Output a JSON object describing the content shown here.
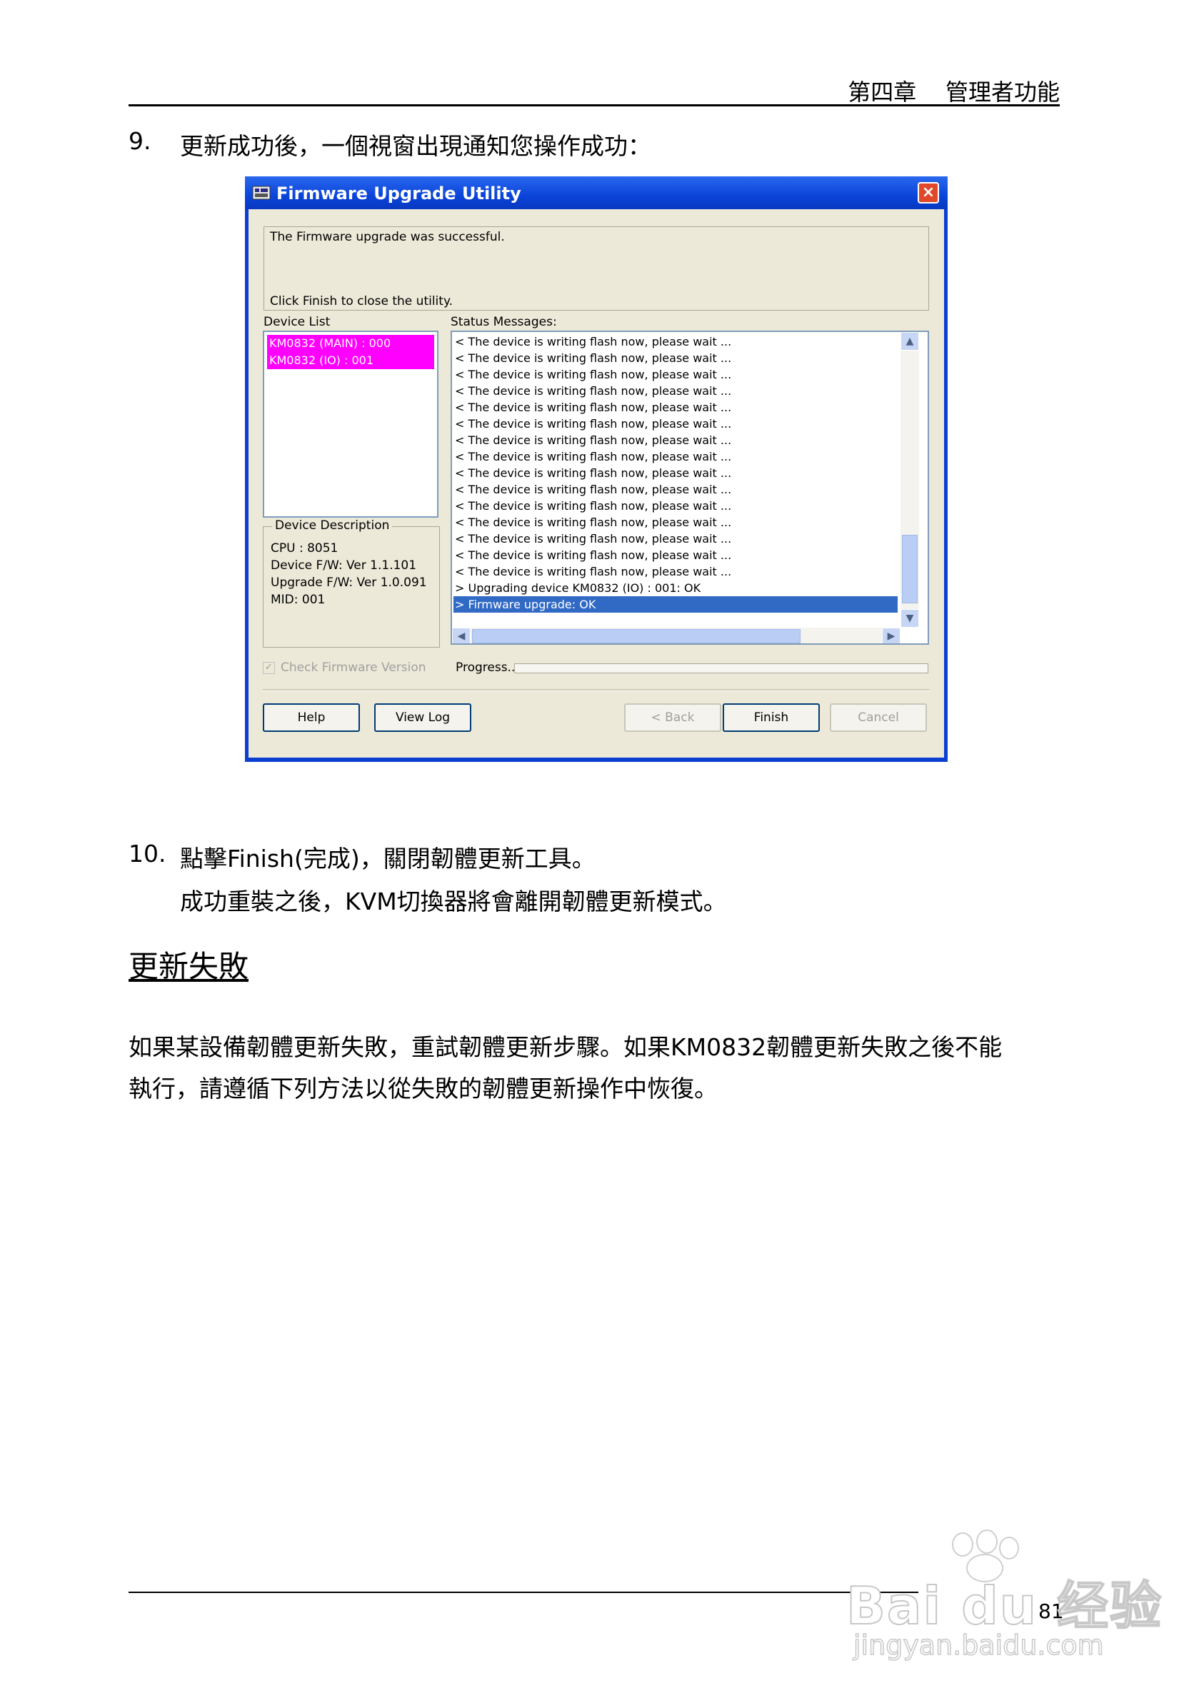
{
  "header": {
    "chapter": "第四章    管理者功能"
  },
  "step9": {
    "number": "9.",
    "text": "更新成功後，一個視窗出現通知您操作成功："
  },
  "dialog": {
    "title": "Firmware Upgrade Utility",
    "close_glyph": "×",
    "message_line1": "The Firmware upgrade was successful.",
    "message_line2": "Click Finish to close the utility.",
    "device_list_label": "Device List",
    "devices": [
      "KM0832 (MAIN) : 000",
      "KM0832 (IO) : 001"
    ],
    "status_label": "Status Messages:",
    "status_messages": [
      "< The device is writing flash now, please wait ...",
      "< The device is writing flash now, please wait ...",
      "< The device is writing flash now, please wait ...",
      "< The device is writing flash now, please wait ...",
      "< The device is writing flash now, please wait ...",
      "< The device is writing flash now, please wait ...",
      "< The device is writing flash now, please wait ...",
      "< The device is writing flash now, please wait ...",
      "< The device is writing flash now, please wait ...",
      "< The device is writing flash now, please wait ...",
      "< The device is writing flash now, please wait ...",
      "< The device is writing flash now, please wait ...",
      "< The device is writing flash now, please wait ...",
      "< The device is writing flash now, please wait ...",
      "< The device is writing flash now, please wait ...",
      "> Upgrading device KM0832 (IO) : 001: OK",
      "> Firmware upgrade: OK"
    ],
    "device_description": {
      "title": "Device Description",
      "lines": [
        "CPU : 8051",
        "Device F/W: Ver 1.1.101",
        "Upgrade F/W: Ver 1.0.091",
        "MID: 001"
      ]
    },
    "check_label": "Check Firmware Version",
    "progress_label": "Progress...",
    "buttons": {
      "help": "Help",
      "view_log": "View Log",
      "back": "< Back",
      "finish": "Finish",
      "cancel": "Cancel"
    }
  },
  "step10": {
    "number": "10.",
    "line1": "點擊Finish(完成)，關閉韌體更新工具。",
    "line2": "成功重裝之後，KVM切換器將會離開韌體更新模式。"
  },
  "section": {
    "title": "更新失敗",
    "para_line1": "如果某設備韌體更新失敗，重試韌體更新步驟。如果KM0832韌體更新失敗之後不能",
    "para_line2": "執行，請遵循下列方法以從失敗的韌體更新操作中恢復。"
  },
  "footer": {
    "page_number": "81"
  },
  "watermark": {
    "brand": "Bai du 经验",
    "url": "jingyan.baidu.com"
  }
}
